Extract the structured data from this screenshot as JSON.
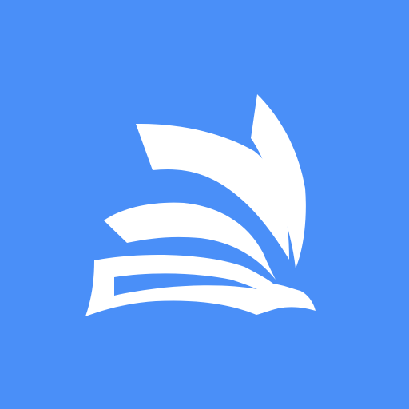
{
  "app_icon": {
    "background_color": "#4a8ff8",
    "mark_color": "#ffffff",
    "icon_name": "open-book-pages-icon"
  }
}
